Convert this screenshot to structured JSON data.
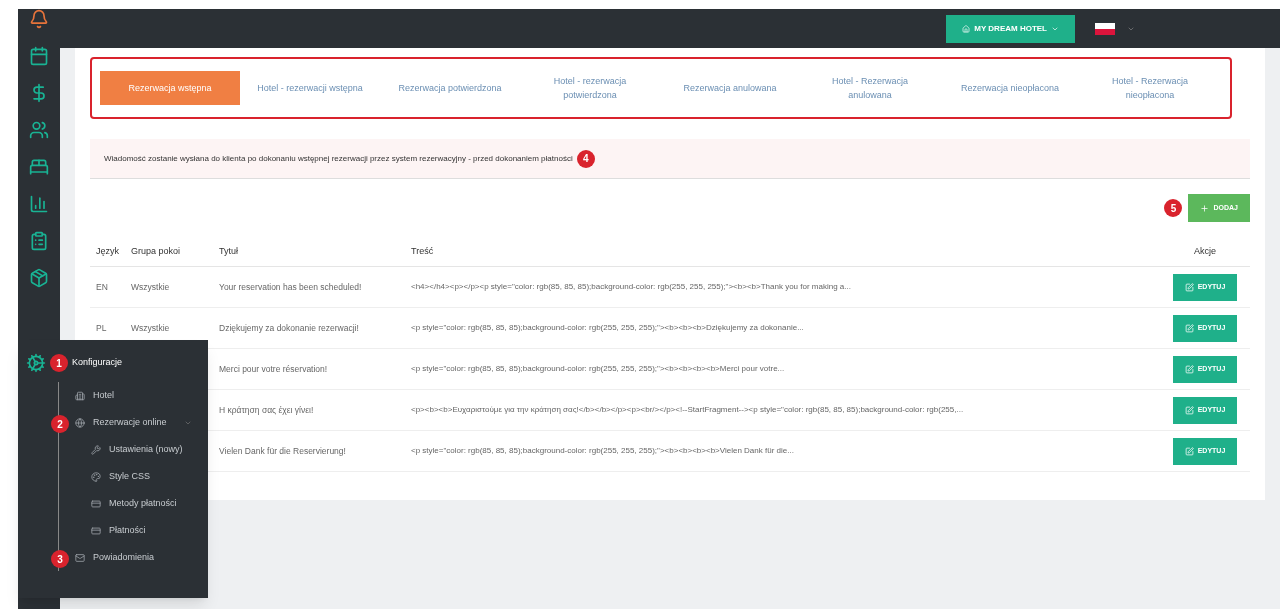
{
  "header": {
    "hotel_button": "MY DREAM HOTEL"
  },
  "sidebar": {
    "items": [
      {
        "kind": "bell"
      },
      {
        "kind": "calendar"
      },
      {
        "kind": "dollar"
      },
      {
        "kind": "users"
      },
      {
        "kind": "bed"
      },
      {
        "kind": "chart"
      },
      {
        "kind": "clipboard"
      },
      {
        "kind": "package"
      }
    ]
  },
  "tabs": [
    {
      "label": "Rezerwacja wstępna",
      "selected": true
    },
    {
      "label": "Hotel - rezerwacji wstępna",
      "selected": false
    },
    {
      "label": "Rezerwacja potwierdzona",
      "selected": false
    },
    {
      "label": "Hotel - rezerwacja potwierdzona",
      "selected": false
    },
    {
      "label": "Rezerwacja anulowana",
      "selected": false
    },
    {
      "label": "Hotel - Rezerwacja anulowana",
      "selected": false
    },
    {
      "label": "Rezerwacja nieopłacona",
      "selected": false
    },
    {
      "label": "Hotel - Rezerwacja nieopłacona",
      "selected": false
    }
  ],
  "message": {
    "text": "Wiadomość zostanie wysłana do klienta po dokonaniu wstępnej rezerwacji przez system rezerwacyjny - przed dokonaniem płatności",
    "badge": "4"
  },
  "add_button": {
    "label": "DODAJ",
    "badge": "5"
  },
  "table": {
    "columns": [
      "Język",
      "Grupa pokoi",
      "Tytuł",
      "Treść",
      "Akcje"
    ],
    "rows": [
      {
        "language": "EN",
        "room_group": "Wszystkie",
        "title": "Your reservation has been scheduled!",
        "content": "<h4></h4><p></p><p style=\"color: rgb(85, 85, 85);background-color: rgb(255, 255, 255);\"><b><b>Thank you for making a...",
        "action": "EDYTUJ"
      },
      {
        "language": "PL",
        "room_group": "Wszystkie",
        "title": "Dziękujemy za dokonanie rezerwacji!",
        "content": "<p style=\"color: rgb(85, 85, 85);background-color: rgb(255, 255, 255);\"><b><b><b>Dziękujemy za dokonanie...",
        "action": "EDYTUJ"
      },
      {
        "title": "Merci pour votre réservation!",
        "content": "<p style=\"color: rgb(85, 85, 85);background-color: rgb(255, 255, 255);\"><b><b><b><b>Merci pour votre...",
        "action": "EDYTUJ"
      },
      {
        "title": "Η κράτηση σας έχει γίνει!",
        "content": "<p><b><b>Ευχαριστούμε για την κράτηση σας!</b></b></p><p><br/></p><!--StartFragment--><p style=\"color: rgb(85, 85, 85);background-color: rgb(255,...",
        "action": "EDYTUJ"
      },
      {
        "title": "Vielen Dank für die Reservierung!",
        "content": "<p style=\"color: rgb(85, 85, 85);background-color: rgb(255, 255, 255);\"><b><b><b><b>Vielen Dank für die...",
        "action": "EDYTUJ"
      }
    ]
  },
  "flyout_menu": {
    "title": "Konfiguracje",
    "badge": "1",
    "items": [
      {
        "label": "Hotel",
        "kind": "building"
      },
      {
        "label": "Rezerwacje online",
        "kind": "globe",
        "badge": "2",
        "expanded": true,
        "children": [
          {
            "label": "Ustawienia (nowy)",
            "kind": "wrench"
          },
          {
            "label": "Style CSS",
            "kind": "palette"
          },
          {
            "label": "Metody płatności",
            "kind": "card"
          },
          {
            "label": "Płatności",
            "kind": "card"
          }
        ]
      },
      {
        "label": "Powiadomienia",
        "kind": "mail",
        "badge": "3"
      }
    ]
  }
}
